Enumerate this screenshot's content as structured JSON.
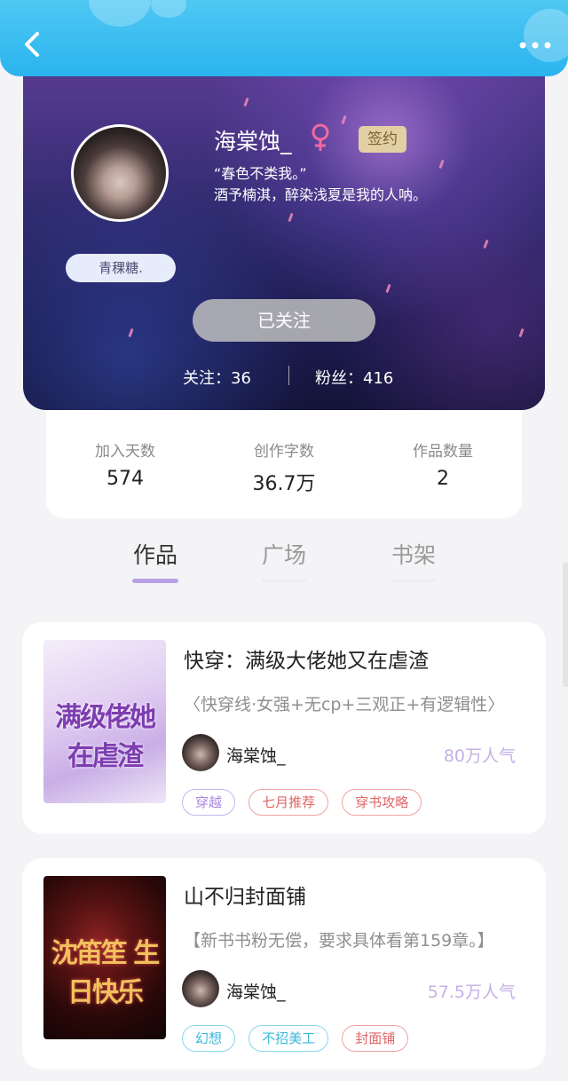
{
  "profile": {
    "username": "海棠蚀_",
    "signed_label": "签约",
    "bio_line1": "“春色不类我。”",
    "bio_line2": "酒予楠淇，醉染浅夏是我的人呐。",
    "badge": "青稞糖.",
    "follow_button": "已关注",
    "following": "关注：36",
    "fans": "粉丝：416"
  },
  "stats": [
    {
      "label": "加入天数",
      "value": "574"
    },
    {
      "label": "创作字数",
      "value": "36.7万"
    },
    {
      "label": "作品数量",
      "value": "2"
    }
  ],
  "tabs": [
    {
      "label": "作品",
      "active": true
    },
    {
      "label": "广场",
      "active": false
    },
    {
      "label": "书架",
      "active": false
    }
  ],
  "books": [
    {
      "title": "快穿：满级大佬她又在虐渣",
      "desc": "〈快穿线·女强+无cp+三观正+有逻辑性〉",
      "author": "海棠蚀_",
      "popularity": "80万人气",
      "cover_text": "满级佬她 在虐渣",
      "tags": [
        "穿越",
        "七月推荐",
        "穿书攻略"
      ]
    },
    {
      "title": "山不归封面铺",
      "desc": "【新书书粉无偿，要求具体看第159章。】",
      "author": "海棠蚀_",
      "popularity": "57.5万人气",
      "cover_text": "沈笛笙 生日快乐",
      "tags": [
        "幻想",
        "不招美工",
        "封面铺"
      ]
    }
  ],
  "colors": {
    "topbar": "#2ab4ee",
    "accent": "#b9a1e6",
    "popularity": "#c4b0e6"
  }
}
